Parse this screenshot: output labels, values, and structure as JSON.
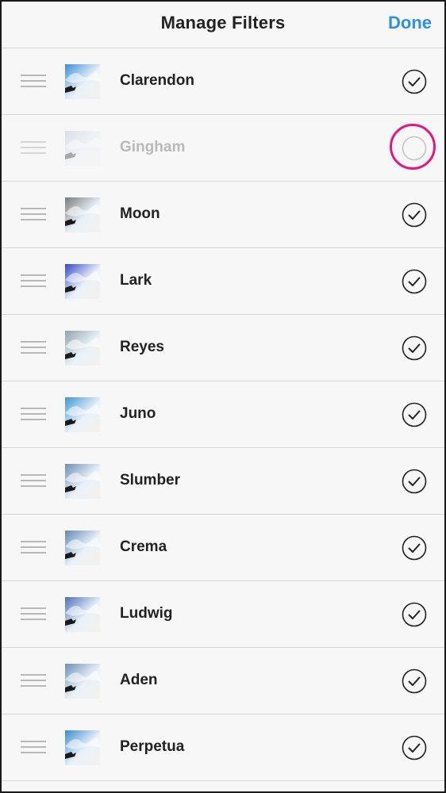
{
  "header": {
    "title": "Manage Filters",
    "done_label": "Done"
  },
  "colors": {
    "accent": "#2d8fe6",
    "highlight": "#e6157f",
    "separator": "#d6d6d6"
  },
  "filters": [
    {
      "name": "Clarendon",
      "enabled": true,
      "tint": "#3a8fd8"
    },
    {
      "name": "Gingham",
      "enabled": false,
      "tint": "#9fb6c9"
    },
    {
      "name": "Moon",
      "enabled": true,
      "tint": "#7a7a7a"
    },
    {
      "name": "Lark",
      "enabled": true,
      "tint": "#3347c9"
    },
    {
      "name": "Reyes",
      "enabled": true,
      "tint": "#8fa3ad"
    },
    {
      "name": "Juno",
      "enabled": true,
      "tint": "#3c95d6"
    },
    {
      "name": "Slumber",
      "enabled": true,
      "tint": "#6f8db6"
    },
    {
      "name": "Crema",
      "enabled": true,
      "tint": "#5f88b6"
    },
    {
      "name": "Ludwig",
      "enabled": true,
      "tint": "#4a6fb8"
    },
    {
      "name": "Aden",
      "enabled": true,
      "tint": "#6a90b5"
    },
    {
      "name": "Perpetua",
      "enabled": true,
      "tint": "#3c8bd0"
    }
  ],
  "icons": {
    "drag": "drag-handle-icon",
    "enabled": "checkmark-circle-icon",
    "disabled": "empty-circle-icon"
  }
}
